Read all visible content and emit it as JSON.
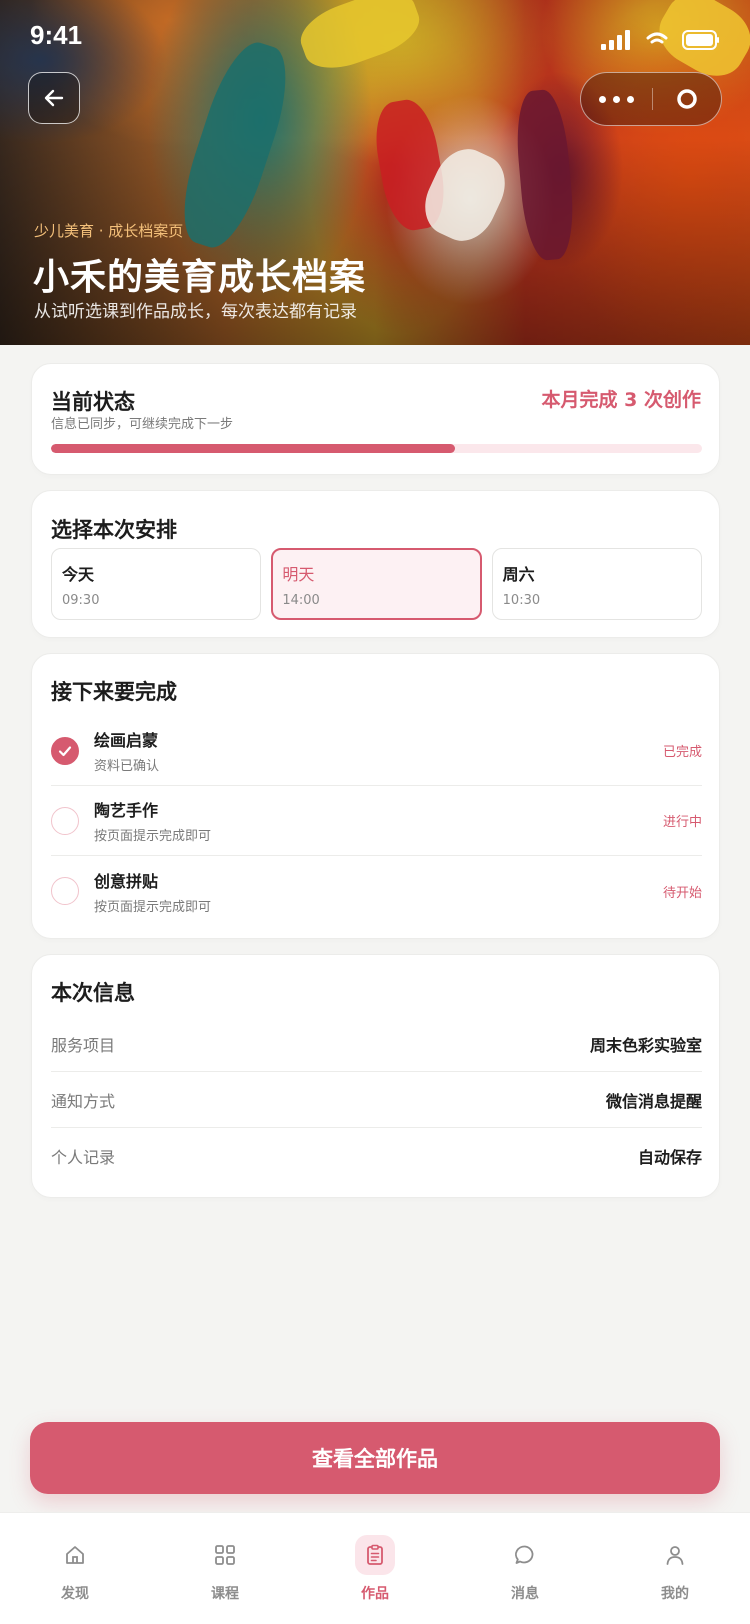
{
  "status_bar": {
    "time": "9:41"
  },
  "hero": {
    "eyebrow": "少儿美育 · 成长档案页",
    "title": "小禾的美育成长档案",
    "subtitle": "从试听选课到作品成长，每次表达都有记录"
  },
  "status_card": {
    "title": "当前状态",
    "hint": "信息已同步，可继续完成下一步",
    "month_done": "本月完成 3 次创作",
    "progress_fraction": 0.62
  },
  "schedule": {
    "title": "选择本次安排",
    "slots": [
      {
        "day": "今天",
        "time": "09:30",
        "selected": false
      },
      {
        "day": "明天",
        "time": "14:00",
        "selected": true
      },
      {
        "day": "周六",
        "time": "10:30",
        "selected": false
      }
    ]
  },
  "todo": {
    "title": "接下来要完成",
    "items": [
      {
        "name": "绘画启蒙",
        "desc": "资料已确认",
        "state": "已完成",
        "done": true
      },
      {
        "name": "陶艺手作",
        "desc": "按页面提示完成即可",
        "state": "进行中",
        "done": false
      },
      {
        "name": "创意拼贴",
        "desc": "按页面提示完成即可",
        "state": "待开始",
        "done": false
      }
    ]
  },
  "info": {
    "title": "本次信息",
    "rows": [
      {
        "label": "服务项目",
        "value": "周末色彩实验室"
      },
      {
        "label": "通知方式",
        "value": "微信消息提醒"
      },
      {
        "label": "个人记录",
        "value": "自动保存"
      }
    ]
  },
  "cta": {
    "label": "查看全部作品"
  },
  "tabbar": {
    "active": 2,
    "tabs": [
      {
        "label": "发现",
        "icon": "home-icon"
      },
      {
        "label": "课程",
        "icon": "grid-icon"
      },
      {
        "label": "作品",
        "icon": "clipboard-icon"
      },
      {
        "label": "消息",
        "icon": "chat-bubble-icon"
      },
      {
        "label": "我的",
        "icon": "user-icon"
      }
    ]
  },
  "colors": {
    "accent": "#d65a6f",
    "accent_light": "#fbe5ea",
    "eyebrow": "#f4c07a",
    "background": "#f4f4f2"
  }
}
